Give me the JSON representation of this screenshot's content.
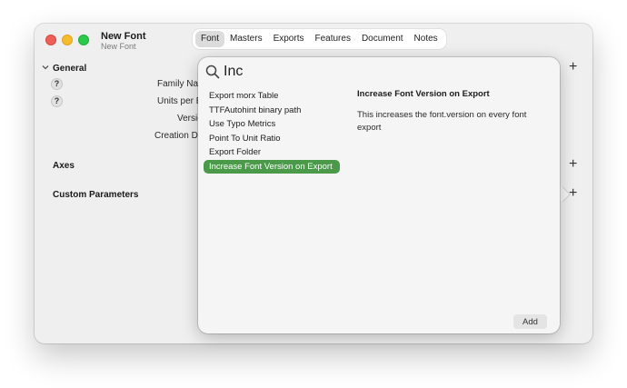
{
  "window": {
    "title": "New Font",
    "subtitle": "New Font"
  },
  "tabs": [
    {
      "label": "Font",
      "active": true
    },
    {
      "label": "Masters",
      "active": false
    },
    {
      "label": "Exports",
      "active": false
    },
    {
      "label": "Features",
      "active": false
    },
    {
      "label": "Document",
      "active": false
    },
    {
      "label": "Notes",
      "active": false
    }
  ],
  "general": {
    "header": "General",
    "help_label": "?",
    "fields": {
      "family_name": "Family Nam",
      "units_per_em": "Units per E",
      "version": "Versio",
      "creation_date": "Creation Da"
    }
  },
  "axes": {
    "header": "Axes"
  },
  "custom_parameters": {
    "header": "Custom Parameters"
  },
  "add_glyph": "+",
  "popover": {
    "search": {
      "value": "Inc",
      "placeholder": ""
    },
    "items": [
      "Export morx Table",
      "TTFAutohint binary path",
      "Use Typo Metrics",
      "Point To Unit Ratio",
      "Export Folder",
      "Increase Font Version on Export"
    ],
    "selected_index": 5,
    "detail": {
      "title": "Increase Font Version on Export",
      "description": "This increases the font.version on every font export"
    },
    "add_label": "Add"
  },
  "colors": {
    "selection": "#4a9a4a",
    "close": "#ee5f57",
    "minimize": "#f5bd2e",
    "maximize": "#2ac94a"
  }
}
